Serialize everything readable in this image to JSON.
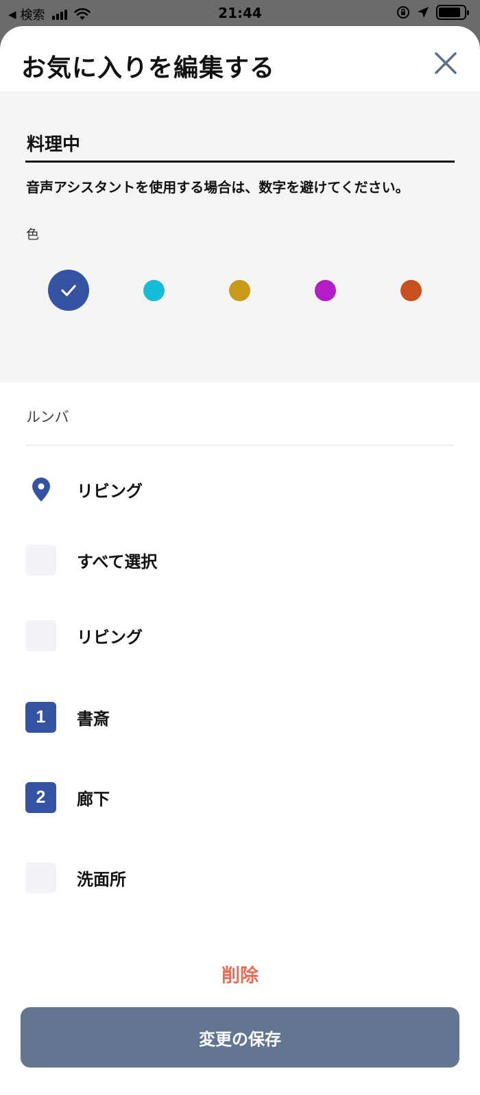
{
  "status_bar": {
    "back_glyph": "◀",
    "carrier": "検索",
    "time": "21:44",
    "battery_level": 0.85
  },
  "sheet": {
    "title": "お気に入りを編集する",
    "close_icon": "close-icon"
  },
  "favorite": {
    "name_value": "料理中",
    "hint": "音声アシスタントを使用する場合は、数字を避けてください。",
    "color_label": "色",
    "colors": [
      {
        "hex": "#3553a5",
        "selected": true
      },
      {
        "hex": "#15bcd8",
        "selected": false
      },
      {
        "hex": "#c99a17",
        "selected": false
      },
      {
        "hex": "#b41cc8",
        "selected": false
      },
      {
        "hex": "#c8501d",
        "selected": false
      }
    ]
  },
  "robot": {
    "name": "ルンバ",
    "map_name": "リビング",
    "select_all": "すべて選択",
    "rooms": [
      {
        "name": "リビング",
        "order": ""
      },
      {
        "name": "書斎",
        "order": "1"
      },
      {
        "name": "廊下",
        "order": "2"
      },
      {
        "name": "洗面所",
        "order": ""
      }
    ]
  },
  "actions": {
    "delete_label": "削除",
    "save_label": "変更の保存"
  },
  "colors": {
    "accent": "#3553a5",
    "delete": "#ef6a50",
    "save_button": "#637691"
  }
}
